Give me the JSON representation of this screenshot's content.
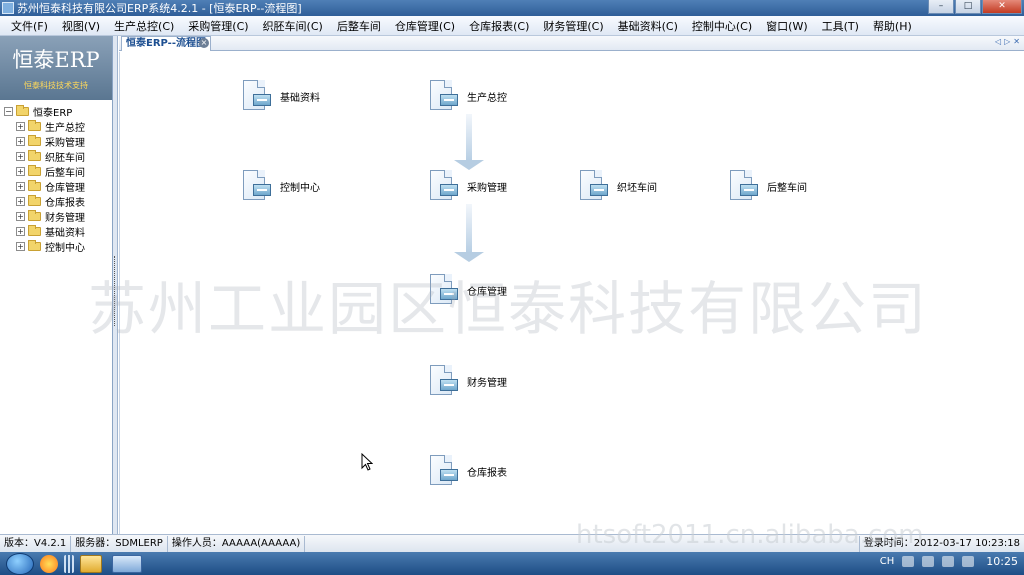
{
  "window": {
    "title": "苏州恒泰科技有限公司ERP系统4.2.1 - [恒泰ERP--流程图]",
    "buttons": [
      "–",
      "□",
      "✕"
    ]
  },
  "menu": [
    "文件(F)",
    "视图(V)",
    "生产总控(C)",
    "采购管理(C)",
    "织胚车间(C)",
    "后整车间",
    "仓库管理(C)",
    "仓库报表(C)",
    "财务管理(C)",
    "基础资料(C)",
    "控制中心(C)",
    "窗口(W)",
    "工具(T)",
    "帮助(H)"
  ],
  "sidebar": {
    "brand": "恒泰ERP",
    "slogan": "恒泰科技技术支持",
    "root": "恒泰ERP",
    "items": [
      "生产总控",
      "采购管理",
      "织胚车间",
      "后整车间",
      "仓库管理",
      "仓库报表",
      "财务管理",
      "基础资料",
      "控制中心"
    ]
  },
  "tab": {
    "label": "恒泰ERP--流程图",
    "close": "×",
    "nav": [
      "◁",
      "▷",
      "✕"
    ]
  },
  "flow": {
    "nodes": [
      "基础资料",
      "生产总控",
      "控制中心",
      "采购管理",
      "织坯车间",
      "后整车间",
      "仓库管理",
      "财务管理",
      "仓库报表"
    ]
  },
  "watermark": {
    "main": "苏州工业园区恒泰科技有限公司",
    "secondary": "htsoft2011.cn.alibaba.com"
  },
  "status": {
    "version": "版本：V4.2.1",
    "server": "服务器：SDMLERP",
    "operator": "操作人员：AAAAA(AAAAA)",
    "login_time": "登录时间：2012-03-17 10:23:18"
  },
  "taskbar": {
    "lang": "CH",
    "clock": "10:25"
  }
}
